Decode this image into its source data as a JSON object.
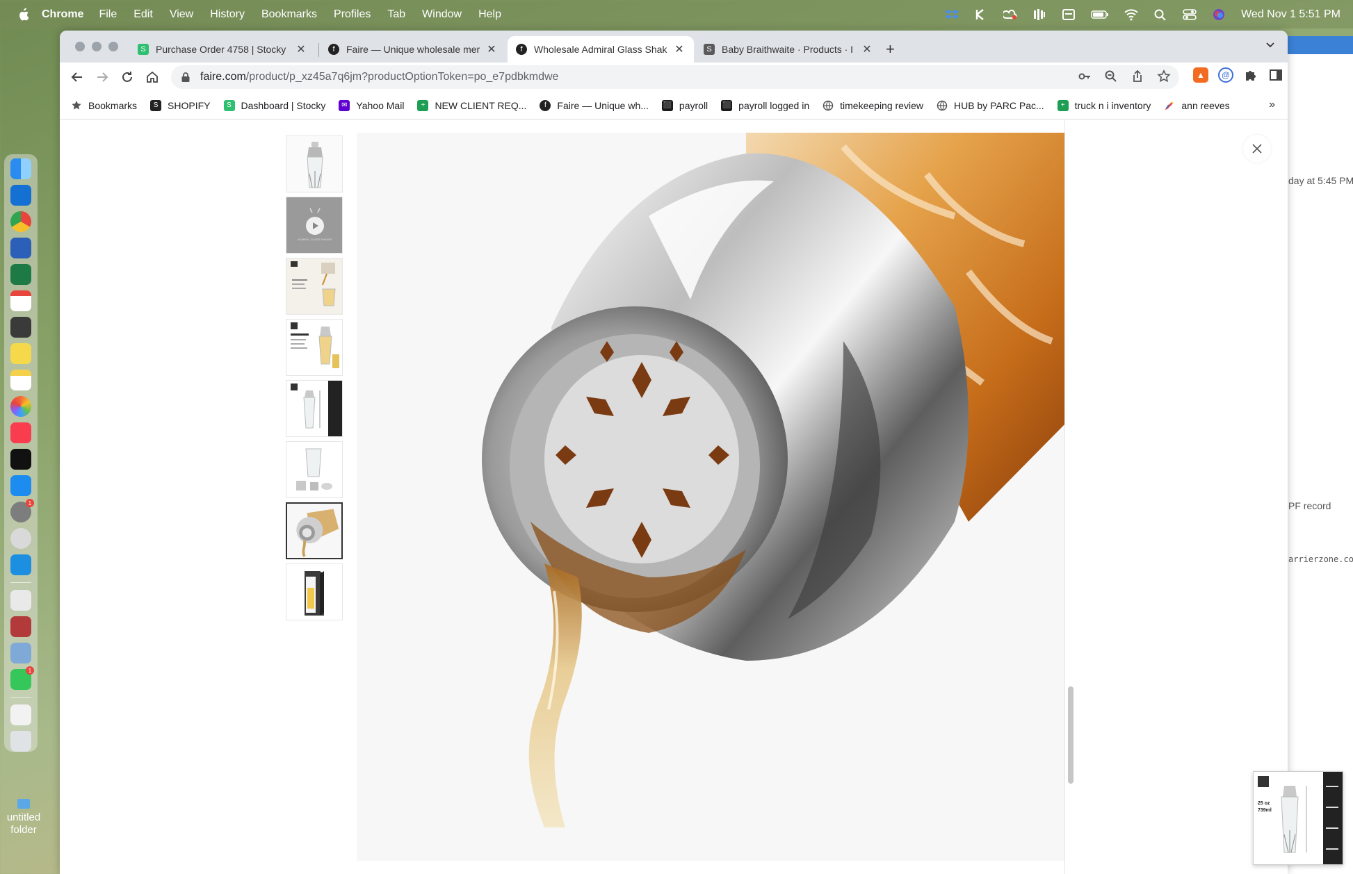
{
  "menubar": {
    "app_name": "Chrome",
    "menus": [
      "File",
      "Edit",
      "View",
      "History",
      "Bookmarks",
      "Profiles",
      "Tab",
      "Window",
      "Help"
    ],
    "clock": "Wed Nov 1  5:51 PM"
  },
  "desktop": {
    "folder_label": "untitled folder"
  },
  "background_window": {
    "line1": "day at 5:45 PM",
    "line2": "PF record",
    "line3": "arrierzone.com"
  },
  "tabs": [
    {
      "title": "Purchase Order 4758 | Stocky",
      "favicon_color": "#2fbf71",
      "active": false
    },
    {
      "title": "Faire — Unique wholesale mer",
      "favicon_color": "#222222",
      "active": false
    },
    {
      "title": "Wholesale Admiral Glass Shak",
      "favicon_color": "#222222",
      "active": true
    },
    {
      "title": "Baby Braithwaite · Products · I",
      "favicon_color": "#5a5a5a",
      "active": false
    }
  ],
  "omnibox": {
    "host": "faire.com",
    "path": "/product/p_xz45a7q6jm?productOptionToken=po_e7pdbkmdwe"
  },
  "profile_initial": "C",
  "bookmarks": [
    {
      "label": "Bookmarks",
      "icon": "star-icon",
      "color": "#555555"
    },
    {
      "label": "SHOPIFY",
      "icon": "shopify-icon",
      "color": "#222222"
    },
    {
      "label": "Dashboard | Stocky",
      "icon": "stocky-icon",
      "color": "#2fbf71"
    },
    {
      "label": "Yahoo Mail",
      "icon": "yahoo-mail-icon",
      "color": "#5f01d1"
    },
    {
      "label": "NEW CLIENT REQ...",
      "icon": "sheets-icon",
      "color": "#1e9e55"
    },
    {
      "label": "Faire — Unique wh...",
      "icon": "faire-icon",
      "color": "#222222"
    },
    {
      "label": "payroll",
      "icon": "payroll-icon",
      "color": "#1a1a1a"
    },
    {
      "label": "payroll logged in",
      "icon": "payroll-icon",
      "color": "#1a1a1a"
    },
    {
      "label": "timekeeping review",
      "icon": "globe-icon",
      "color": "#555555"
    },
    {
      "label": "HUB by PARC Pac...",
      "icon": "globe-icon",
      "color": "#555555"
    },
    {
      "label": "truck n i inventory",
      "icon": "sheets-icon",
      "color": "#1e9e55"
    },
    {
      "label": "ann reeves",
      "icon": "pen-icon",
      "color": "#e8453c"
    }
  ],
  "gallery": {
    "thumb_count": 8,
    "selected_index": 6,
    "video_index": 1,
    "video_caption": "ADMIRAL GLASS SHAKER",
    "float_text_a": "25 oz",
    "float_text_b": "739ml"
  },
  "colors": {
    "accent_profile": "#d9326a",
    "amber_liquid": "#c97a1e"
  }
}
